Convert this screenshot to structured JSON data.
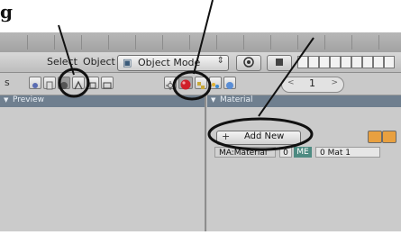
{
  "caption": {
    "text": "g"
  },
  "header": {
    "select_label": "Select",
    "object_label": "Object",
    "mode_icon": "cube-mode-icon",
    "mode_label": "Object Mode",
    "mode_arrow": "⇕"
  },
  "toolbar": {
    "prefix": "s",
    "frame_value": "1",
    "frame_prev": "<",
    "frame_next": ">"
  },
  "panels": {
    "left_title": "Preview",
    "right_title": "Material"
  },
  "material": {
    "add_new_label": "Add New",
    "add_new_icon": "+",
    "ma_label": "MA:Material",
    "chip1": "0",
    "chip2": "ME",
    "chip3": "0 Mat 1"
  }
}
